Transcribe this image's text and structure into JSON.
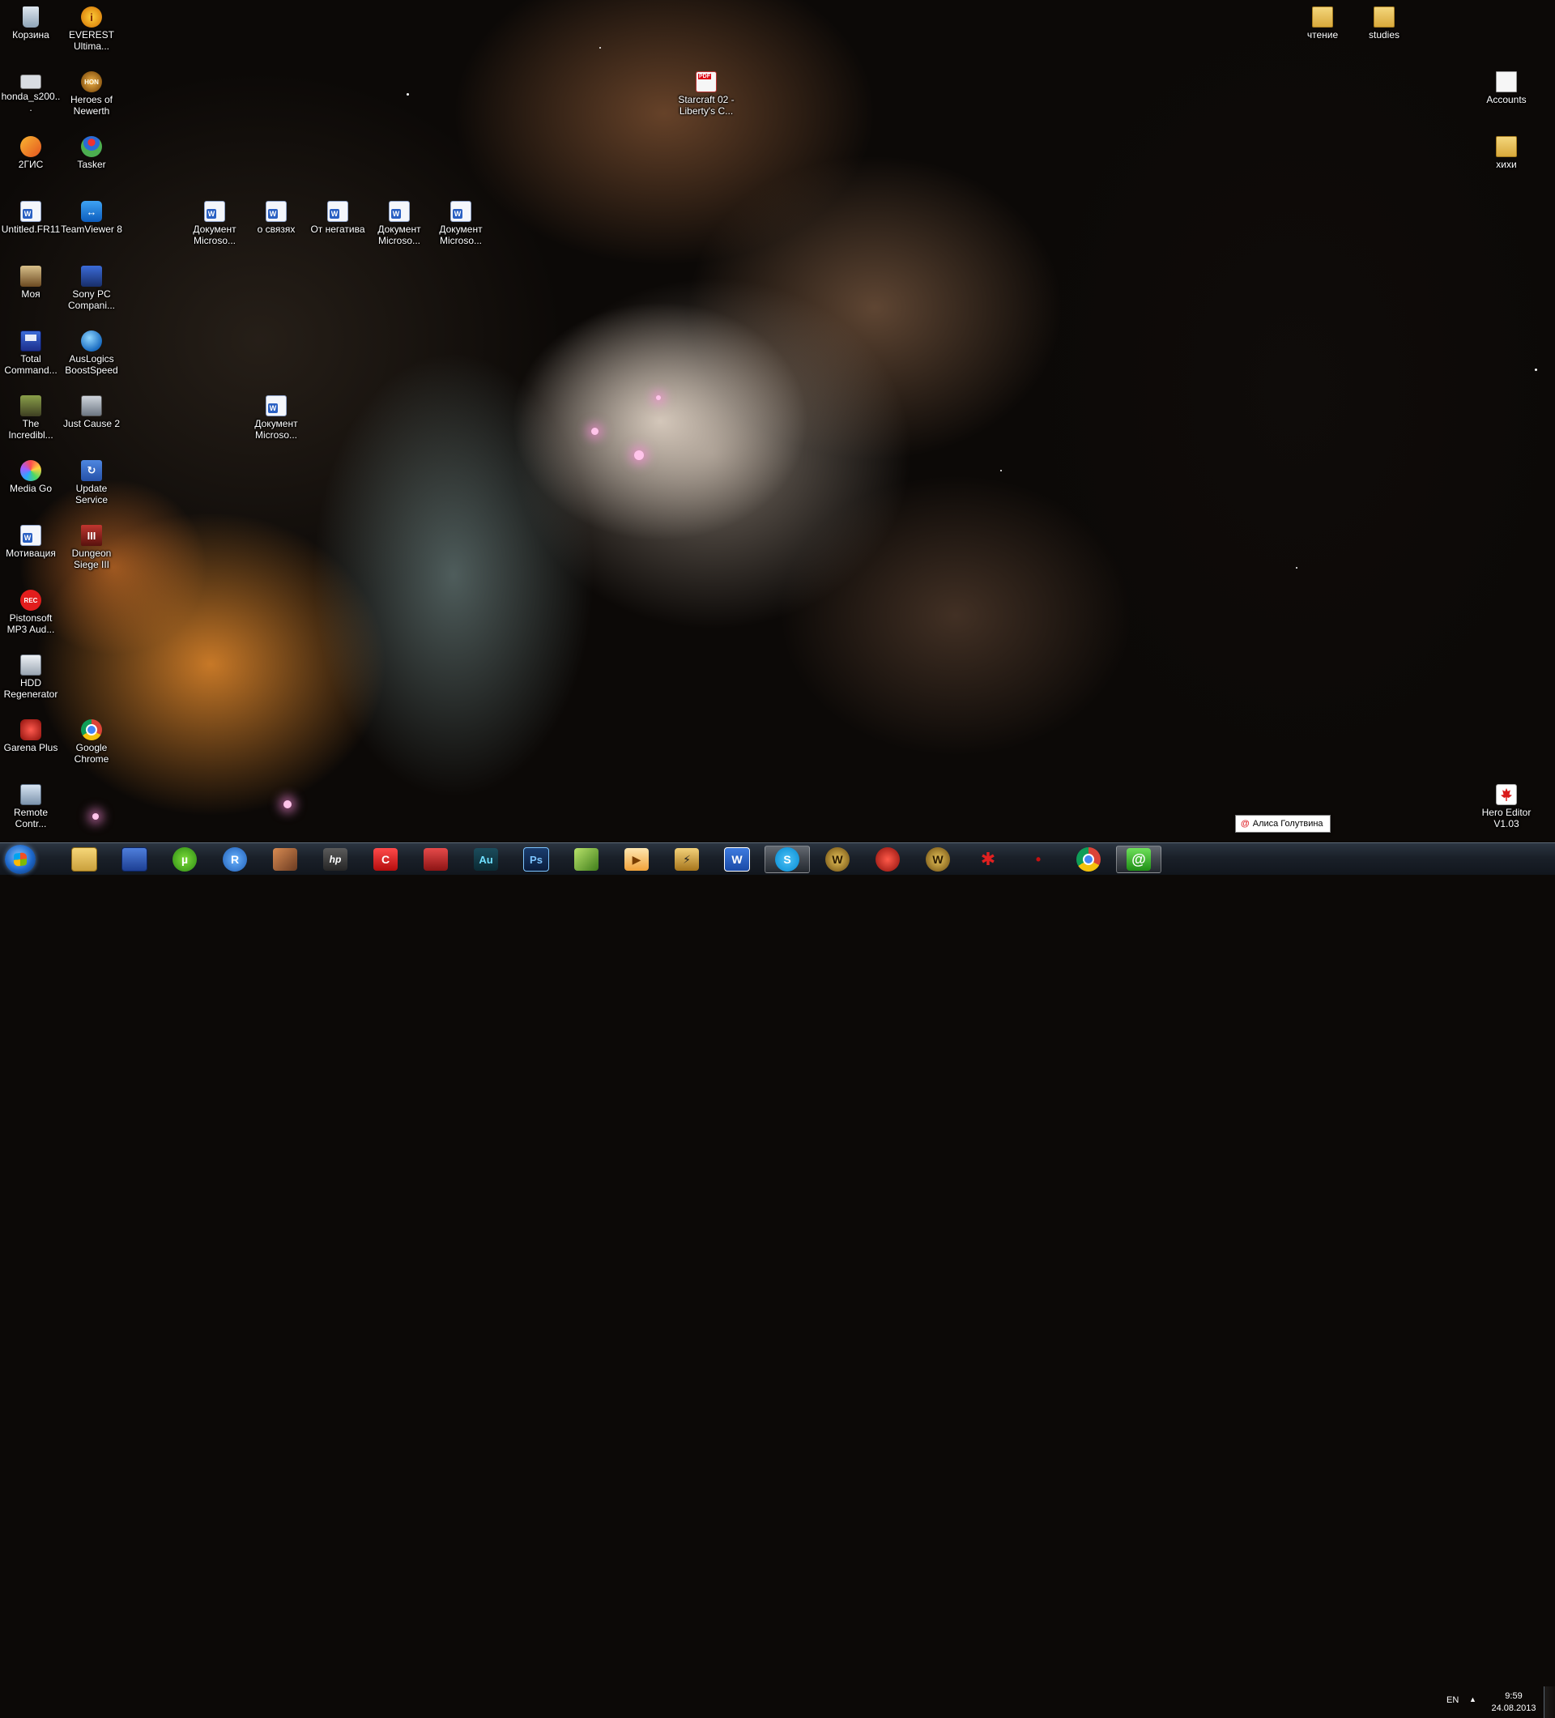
{
  "desktop_icons": [
    {
      "label": "Корзина",
      "icon": "recycle-bin-icon"
    },
    {
      "label": "EVEREST Ultima...",
      "icon": "everest-icon"
    },
    {
      "label": "honda_s200...",
      "icon": "image-file-icon"
    },
    {
      "label": "Heroes of Newerth",
      "icon": "heroes-of-newerth-icon"
    },
    {
      "label": "2ГИС",
      "icon": "2gis-icon"
    },
    {
      "label": "Tasker",
      "icon": "tasker-icon"
    },
    {
      "label": "Untitled.FR11",
      "icon": "word-doc-icon"
    },
    {
      "label": "TeamViewer 8",
      "icon": "teamviewer-icon"
    },
    {
      "label": "Моя",
      "icon": "image-file-icon"
    },
    {
      "label": "Sony PC Compani...",
      "icon": "sony-pc-companion-icon"
    },
    {
      "label": "Total Command...",
      "icon": "total-commander-icon"
    },
    {
      "label": "AusLogics BoostSpeed",
      "icon": "auslogics-icon"
    },
    {
      "label": "The Incredibl...",
      "icon": "incredible-hulk-icon"
    },
    {
      "label": "Just Cause 2",
      "icon": "just-cause-icon"
    },
    {
      "label": "Media Go",
      "icon": "media-go-icon"
    },
    {
      "label": "Update Service",
      "icon": "update-service-icon"
    },
    {
      "label": "Мотивация",
      "icon": "word-doc-icon"
    },
    {
      "label": "Dungeon Siege III",
      "icon": "dungeon-siege-icon"
    },
    {
      "label": "Pistonsoft MP3 Aud...",
      "icon": "rec-icon"
    },
    {
      "label": "HDD Regenerator",
      "icon": "hdd-regenerator-icon"
    },
    {
      "label": "Garena Plus",
      "icon": "garena-icon"
    },
    {
      "label": "Google Chrome",
      "icon": "chrome-icon"
    },
    {
      "label": "Remote Contr...",
      "icon": "remote-control-icon"
    },
    {
      "label": "Документ Microso...",
      "icon": "word-doc-icon"
    },
    {
      "label": "о связях",
      "icon": "word-doc-icon"
    },
    {
      "label": "От негатива",
      "icon": "word-doc-icon"
    },
    {
      "label": "Документ Microso...",
      "icon": "word-doc-icon"
    },
    {
      "label": "Документ Microso...",
      "icon": "word-doc-icon"
    },
    {
      "label": "Документ Microso...",
      "icon": "word-doc-icon"
    },
    {
      "label": "Starcraft 02 - Liberty's C...",
      "icon": "pdf-icon"
    },
    {
      "label": "чтение",
      "icon": "folder-icon"
    },
    {
      "label": "studies",
      "icon": "folder-icon"
    },
    {
      "label": "Accounts",
      "icon": "text-file-icon"
    },
    {
      "label": "хихи",
      "icon": "folder-icon"
    },
    {
      "label": "Hero Editor V1.03",
      "icon": "canada-flag-icon"
    }
  ],
  "notification": {
    "text": "Алиса Голутвина",
    "icon": "mail-agent-icon"
  },
  "taskbar": {
    "start_icon": "windows-start-icon",
    "pinned": [
      {
        "icon": "explorer-icon",
        "glyph": ""
      },
      {
        "icon": "save-disk-icon",
        "glyph": ""
      },
      {
        "icon": "utorrent-icon",
        "glyph": "µ"
      },
      {
        "icon": "r-app-icon",
        "glyph": "R"
      },
      {
        "icon": "game-icon",
        "glyph": ""
      },
      {
        "icon": "hp-icon",
        "glyph": "hp"
      },
      {
        "icon": "red-c-app-icon",
        "glyph": "C"
      },
      {
        "icon": "red-book-icon",
        "glyph": ""
      },
      {
        "icon": "audition-icon",
        "glyph": "Au"
      },
      {
        "icon": "photoshop-icon",
        "glyph": "Ps"
      },
      {
        "icon": "feather-app-icon",
        "glyph": ""
      },
      {
        "icon": "media-player-icon",
        "glyph": "▶"
      },
      {
        "icon": "bolt-app-icon",
        "glyph": "⚡"
      },
      {
        "icon": "word-icon",
        "glyph": "W"
      },
      {
        "icon": "skype-icon",
        "glyph": "S"
      },
      {
        "icon": "warcraft-icon",
        "glyph": "W"
      },
      {
        "icon": "red-potion-icon",
        "glyph": ""
      },
      {
        "icon": "warcraft-icon",
        "glyph": "W"
      },
      {
        "icon": "spider-icon",
        "glyph": "✱"
      },
      {
        "icon": "red-dot-icon",
        "glyph": "•"
      },
      {
        "icon": "chrome-icon",
        "glyph": ""
      },
      {
        "icon": "mail-agent-icon",
        "glyph": "@"
      }
    ],
    "active_buttons": [
      "skype-icon",
      "mail-agent-icon"
    ],
    "lang": "EN",
    "time": "9:59",
    "date": "24.08.2013"
  },
  "colors": {
    "taskbar_top": "#2c3541",
    "taskbar_bottom": "#11161d",
    "label_text": "#ffffff"
  }
}
